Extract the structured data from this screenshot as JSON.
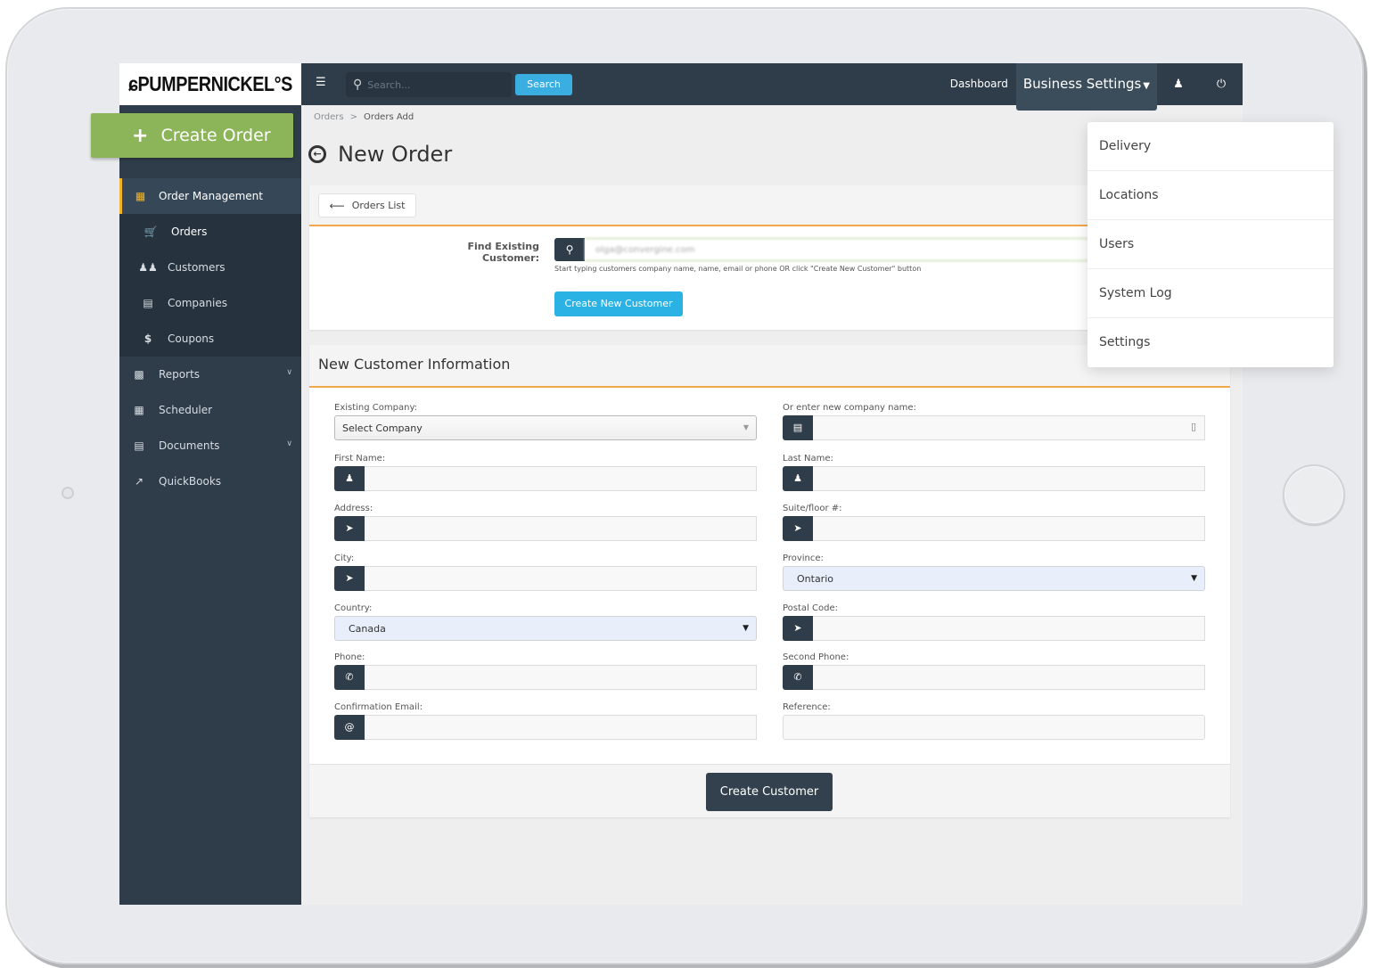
{
  "brand": {
    "logo_text": "ɕPUMPERNICKEL°S"
  },
  "topbar": {
    "menu_icon": "menu-icon",
    "search_placeholder": "Search...",
    "search_button": "Search",
    "nav": {
      "dashboard": "Dashboard",
      "business_settings": "Business Settings",
      "user_icon": "user-icon",
      "power_icon": "power-icon"
    }
  },
  "sidebar": {
    "create_order": "Create Order",
    "items": [
      {
        "label": "Order Management",
        "icon": "grid-icon",
        "state": "active"
      },
      {
        "label": "Orders",
        "icon": "cart-icon",
        "state": "sub-current"
      },
      {
        "label": "Customers",
        "icon": "users-icon",
        "state": "sub"
      },
      {
        "label": "Companies",
        "icon": "building-icon",
        "state": "sub"
      },
      {
        "label": "Coupons",
        "icon": "dollar-icon",
        "state": "sub"
      },
      {
        "label": "Reports",
        "icon": "bar-chart-icon",
        "state": "expandable"
      },
      {
        "label": "Scheduler",
        "icon": "calendar-icon",
        "state": "normal"
      },
      {
        "label": "Documents",
        "icon": "document-icon",
        "state": "expandable"
      },
      {
        "label": "QuickBooks",
        "icon": "external-link-icon",
        "state": "normal"
      }
    ]
  },
  "breadcrumb": {
    "parent": "Orders",
    "separator": ">",
    "current": "Orders Add"
  },
  "page": {
    "title": "New Order"
  },
  "find_customer": {
    "orders_list_button": "Orders List",
    "label": "Find Existing Customer:",
    "value": "olga@convergine.com",
    "help": "Start typing customers company name, name, email or phone OR click \"Create New Customer\" button",
    "create_new_button": "Create New Customer"
  },
  "new_customer": {
    "title": "New Customer Information",
    "fields": {
      "existing_company": {
        "label": "Existing Company:",
        "value": "Select Company"
      },
      "new_company": {
        "label": "Or enter new company name:",
        "value": ""
      },
      "first_name": {
        "label": "First Name:",
        "value": ""
      },
      "last_name": {
        "label": "Last Name:",
        "value": ""
      },
      "address": {
        "label": "Address:",
        "value": ""
      },
      "suite": {
        "label": "Suite/floor #:",
        "value": ""
      },
      "city": {
        "label": "City:",
        "value": ""
      },
      "province": {
        "label": "Province:",
        "value": "Ontario"
      },
      "country": {
        "label": "Country:",
        "value": "Canada"
      },
      "postal_code": {
        "label": "Postal Code:",
        "value": ""
      },
      "phone": {
        "label": "Phone:",
        "value": ""
      },
      "second_phone": {
        "label": "Second Phone:",
        "value": ""
      },
      "confirmation_email": {
        "label": "Confirmation Email:",
        "value": ""
      },
      "reference": {
        "label": "Reference:",
        "value": ""
      }
    },
    "submit": "Create Customer"
  },
  "business_settings_menu": [
    "Delivery",
    "Locations",
    "Users",
    "System Log",
    "Settings"
  ],
  "colors": {
    "navbar": "#2f3d4a",
    "accent_green": "#8cb55a",
    "accent_blue": "#29b2e3",
    "accent_orange": "#f3a64a",
    "active_yellow": "#f0b429"
  }
}
